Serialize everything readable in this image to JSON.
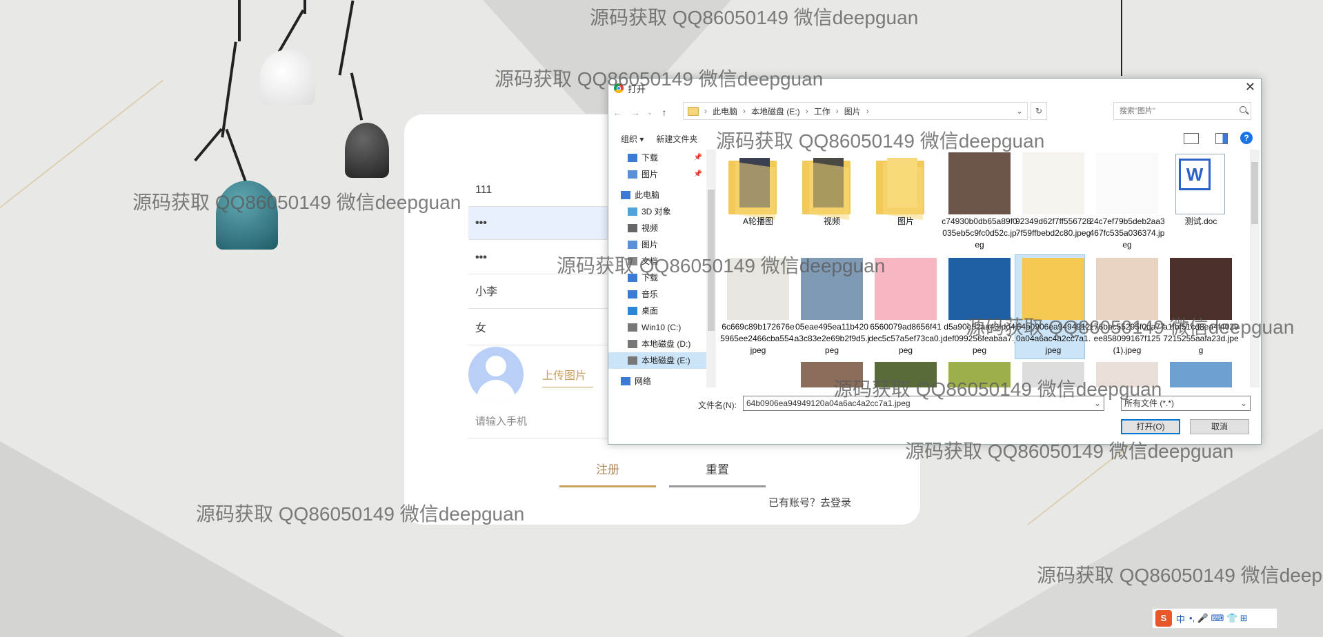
{
  "register_form": {
    "username": "111",
    "password": "•••",
    "confirm_password": "•••",
    "name": "小李",
    "gender": "女",
    "upload_label": "上传图片",
    "phone_placeholder": "请输入手机",
    "register_label": "注册",
    "reset_label": "重置",
    "login_hint": "已有账号？去登录"
  },
  "dialog": {
    "title": "打开",
    "breadcrumb": [
      "此电脑",
      "本地磁盘 (E:)",
      "工作",
      "图片"
    ],
    "search_placeholder": "搜索\"图片\"",
    "toolbar": {
      "organize": "组织 ▾",
      "new_folder": "新建文件夹"
    },
    "sidebar": [
      {
        "label": "下载",
        "icon": "download-icon",
        "pinned": true
      },
      {
        "label": "图片",
        "icon": "pictures-icon",
        "pinned": true
      },
      {
        "label": "此电脑",
        "icon": "computer-icon"
      },
      {
        "label": "3D 对象",
        "icon": "cube-icon"
      },
      {
        "label": "视频",
        "icon": "video-icon"
      },
      {
        "label": "图片",
        "icon": "pictures-icon"
      },
      {
        "label": "文档",
        "icon": "document-icon"
      },
      {
        "label": "下载",
        "icon": "download-icon"
      },
      {
        "label": "音乐",
        "icon": "music-icon"
      },
      {
        "label": "桌面",
        "icon": "desktop-icon"
      },
      {
        "label": "Win10 (C:)",
        "icon": "drive-icon"
      },
      {
        "label": "本地磁盘 (D:)",
        "icon": "drive-icon"
      },
      {
        "label": "本地磁盘 (E:)",
        "icon": "drive-icon",
        "selected": true
      },
      {
        "label": "网络",
        "icon": "network-icon"
      }
    ],
    "files": [
      {
        "name": "A轮播图",
        "kind": "folder",
        "color": "#3a3f52"
      },
      {
        "name": "视频",
        "kind": "folder",
        "color": "#4a4a42"
      },
      {
        "name": "图片",
        "kind": "folder",
        "color": "#f7d97a"
      },
      {
        "name": "c74930b0db65a89f0035eb5c9fc0d52c.jpeg",
        "kind": "image",
        "color": "#6d5448"
      },
      {
        "name": "92349d62f7ff5567287f59ffbebd2c80.jpeg",
        "kind": "image",
        "color": "#f7f3ef"
      },
      {
        "name": "24c7ef79b5deb2aa3467fc535a036374.jpeg",
        "kind": "image",
        "color": "#fafafa"
      },
      {
        "name": "测试.doc",
        "kind": "doc",
        "color": "#2b62c4"
      },
      {
        "name": "6c669c89b172676e5965ee2466cba554.jpeg",
        "kind": "image",
        "color": "#e8e6e0"
      },
      {
        "name": "05eae495ea11b420a3c83e2e69b2f9d5.jpeg",
        "kind": "image",
        "color": "#7f9ab5"
      },
      {
        "name": "6560079ad8656f41dec5c57a5ef73ca0.jpeg",
        "kind": "image",
        "color": "#f6b7c2"
      },
      {
        "name": "d5a90e52aa43fdd4def099256feabaa7.jpeg",
        "kind": "image",
        "color": "#1f5fa3"
      },
      {
        "name": "64b0906ea94949120a04a6ac4a2cc7a1.jpeg",
        "kind": "image",
        "color": "#f4c952",
        "selected": true
      },
      {
        "name": "176bac55295f0da77ee858099167f125(1).jpeg",
        "kind": "image",
        "color": "#e8d2c0"
      },
      {
        "name": "a1fbf51cd8ea4f40297215255aafa23d.jpeg",
        "kind": "image",
        "color": "#4a2f2b"
      }
    ],
    "filename_label": "文件名(N):",
    "filename_value": "64b0906ea94949120a04a6ac4a2cc7a1.jpeg",
    "filetype": "所有文件 (*.*)",
    "open_label": "打开(O)",
    "cancel_label": "取消"
  },
  "watermark": "源码获取 QQ86050149 微信deepguan",
  "ime": {
    "logo": "S",
    "lang": "中",
    "icons": "•, 🎤 ⌨ 👕 ⊞"
  }
}
